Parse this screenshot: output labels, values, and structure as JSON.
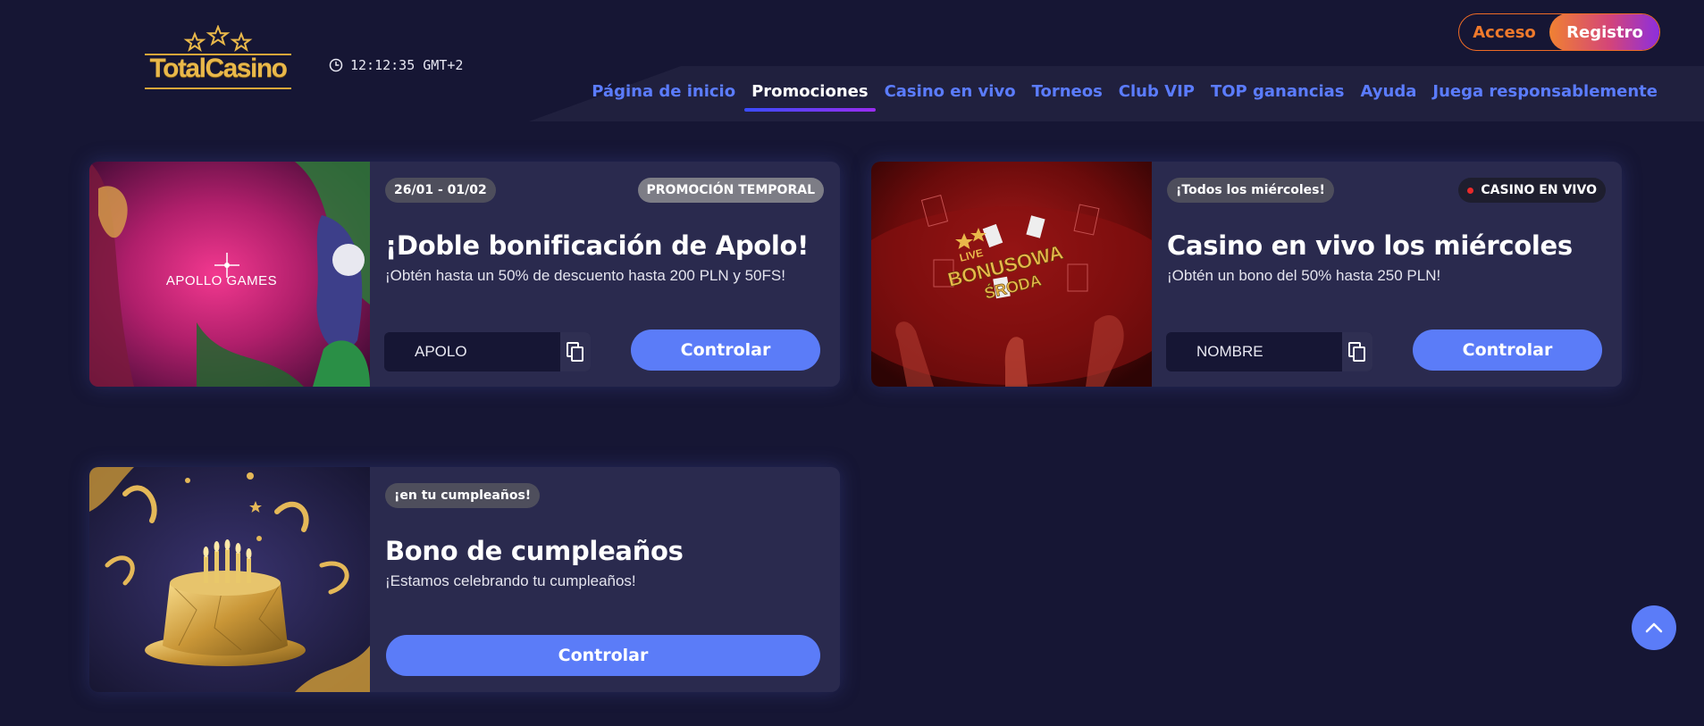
{
  "header": {
    "logo_text": "TotalCasino",
    "clock_text": "12:12:35 GMT+2",
    "login_label": "Acceso",
    "register_label": "Registro"
  },
  "nav": {
    "items": [
      {
        "label": "Página de inicio",
        "active": false
      },
      {
        "label": "Promociones",
        "active": true
      },
      {
        "label": "Casino en vivo",
        "active": false
      },
      {
        "label": "Torneos",
        "active": false
      },
      {
        "label": "Club VIP",
        "active": false
      },
      {
        "label": "TOP ganancias",
        "active": false
      },
      {
        "label": "Ayuda",
        "active": false
      },
      {
        "label": "Juega responsablemente",
        "active": false
      }
    ]
  },
  "promotions": [
    {
      "date_badge": "26/01 - 01/02",
      "type_badge": "PROMOCIÓN TEMPORAL",
      "title": "¡Doble bonificación de Apolo!",
      "subtitle": "¡Obtén hasta un 50% de descuento hasta 200 PLN y 50FS!",
      "promo_code": "APOLO",
      "button_label": "Controlar",
      "image_text": "APOLLO GAMES"
    },
    {
      "date_badge": "¡Todos los miércoles!",
      "type_badge": "CASINO EN VIVO",
      "title": "Casino en vivo los miércoles",
      "subtitle": "¡Obtén un bono del 50% hasta 250 PLN!",
      "promo_code": "NOMBRE",
      "button_label": "Controlar",
      "image_text_top": "LIVE",
      "image_text_main": "BONUSOWA",
      "image_text_bottom": "ŚRODA"
    },
    {
      "date_badge": "¡en tu cumpleaños!",
      "title": "Bono de cumpleaños",
      "subtitle": "¡Estamos celebrando tu cumpleaños!",
      "button_label": "Controlar"
    }
  ],
  "colors": {
    "background": "#161634",
    "card": "#2a2a4e",
    "accent_blue": "#5b7cf8",
    "accent_orange": "#f07a2c",
    "gold": "#e9b84a"
  }
}
